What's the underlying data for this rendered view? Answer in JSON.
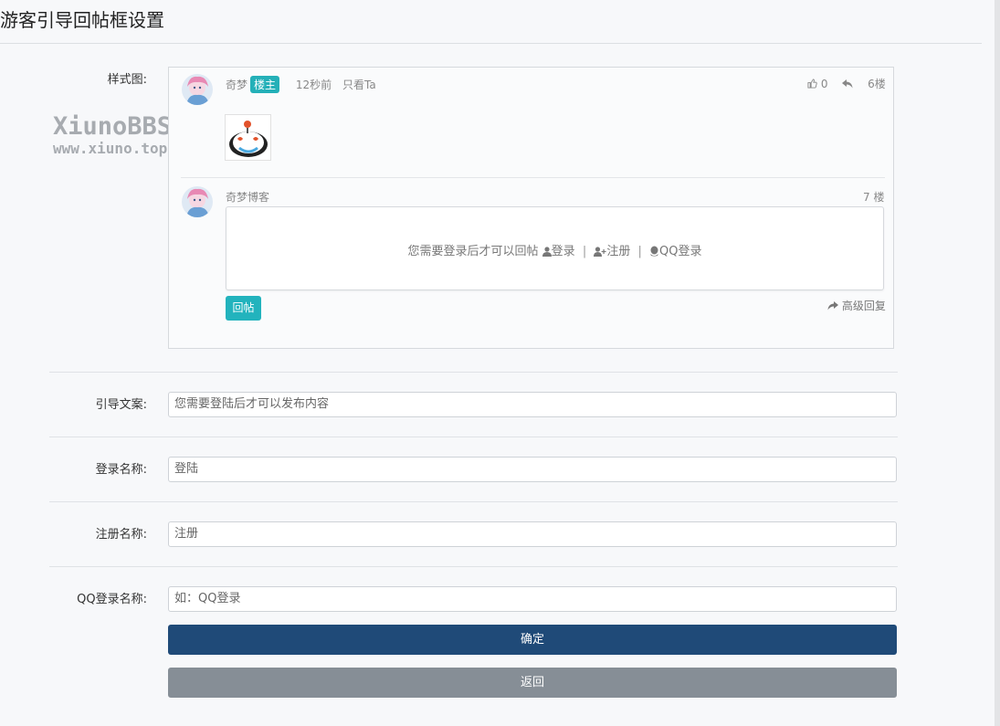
{
  "page": {
    "title": "游客引导回帖框设置"
  },
  "preview_label": "样式图:",
  "preview": {
    "watermark": {
      "line1": "XiunoBBS",
      "line2": "www.xiuno.top"
    },
    "post": {
      "username": "奇梦",
      "badge": "楼主",
      "time": "12秒前",
      "only_view": "只看Ta",
      "likes": "0",
      "floor": "6楼"
    },
    "reply": {
      "username": "奇梦博客",
      "floor": "7 楼",
      "guide_text": "您需要登录后才可以回帖",
      "login": "登录",
      "register": "注册",
      "qq_login": "QQ登录",
      "separator": "|",
      "reply_button": "回帖",
      "advanced_reply": "高级回复"
    }
  },
  "form": {
    "guide_text": {
      "label": "引导文案:",
      "value": "您需要登陆后才可以发布内容"
    },
    "login_name": {
      "label": "登录名称:",
      "value": "登陆"
    },
    "register_name": {
      "label": "注册名称:",
      "value": "注册"
    },
    "qq_login_name": {
      "label": "QQ登录名称:",
      "placeholder": "如：QQ登录"
    }
  },
  "buttons": {
    "confirm": "确定",
    "back": "返回"
  },
  "colors": {
    "primary": "#1f4a78",
    "secondary": "#868e96",
    "accent": "#22b3bd"
  }
}
